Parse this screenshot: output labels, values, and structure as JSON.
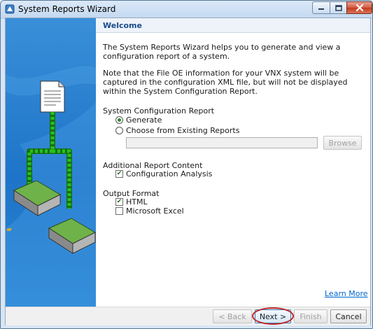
{
  "window": {
    "title": "System Reports Wizard",
    "app_icon": "wizard-app-icon"
  },
  "caption_buttons": {
    "minimize_icon": "minimize-icon",
    "maximize_icon": "maximize-icon",
    "close_icon": "close-icon"
  },
  "side_panel": {
    "illustration": "document-to-storage-arrays-illustration"
  },
  "content": {
    "heading": "Welcome",
    "intro": "The System Reports Wizard helps you to generate and view a configuration report of a system.",
    "note": "Note that the File OE information for your VNX system will be captured in the configuration XML file, but will not be displayed within the System Configuration Report.",
    "system_config": {
      "label": "System Configuration Report",
      "options": [
        {
          "label": "Generate",
          "selected": true
        },
        {
          "label": "Choose from Existing Reports",
          "selected": false
        }
      ],
      "path_value": "",
      "browse_label": "Browse"
    },
    "additional": {
      "label": "Additional Report Content",
      "options": [
        {
          "label": "Configuration Analysis",
          "checked": true
        }
      ]
    },
    "output": {
      "label": "Output Format",
      "options": [
        {
          "label": "HTML",
          "checked": true
        },
        {
          "label": "Microsoft Excel",
          "checked": false
        }
      ]
    },
    "learn_more": "Learn More"
  },
  "footer": {
    "back_label": "< Back",
    "next_label": "Next >",
    "finish_label": "Finish",
    "cancel_label": "Cancel"
  },
  "colors": {
    "side_panel_blue": "#1e74c8",
    "heading_blue": "#1a4a8a",
    "link_blue": "#0066cc",
    "highlight_red": "#c0262c",
    "cable_green": "#22c41c"
  }
}
